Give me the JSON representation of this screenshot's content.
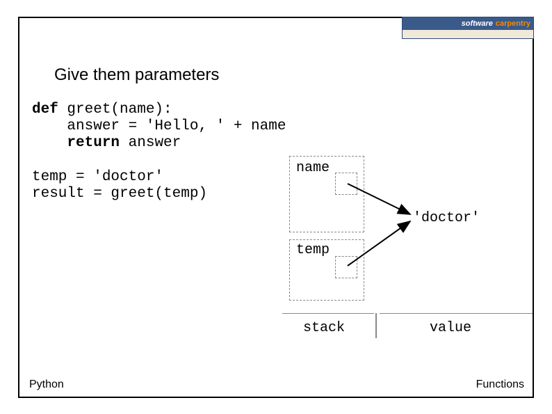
{
  "logo": {
    "software": "software",
    "carpentry": "carpentry"
  },
  "title": "Give them parameters",
  "code": {
    "l1a": "def",
    "l1b": " greet(name):",
    "l2": "    answer = 'Hello, ' + name",
    "l3a": "    ",
    "l3b": "return",
    "l3c": " answer",
    "l4": "",
    "l5": "temp = 'doctor'",
    "l6": "result = greet(temp)"
  },
  "diagram": {
    "box_name_label": "name",
    "box_temp_label": "temp",
    "value_doctor": "'doctor'",
    "col_stack": "stack",
    "col_value": "value"
  },
  "footer": {
    "left": "Python",
    "right": "Functions"
  }
}
